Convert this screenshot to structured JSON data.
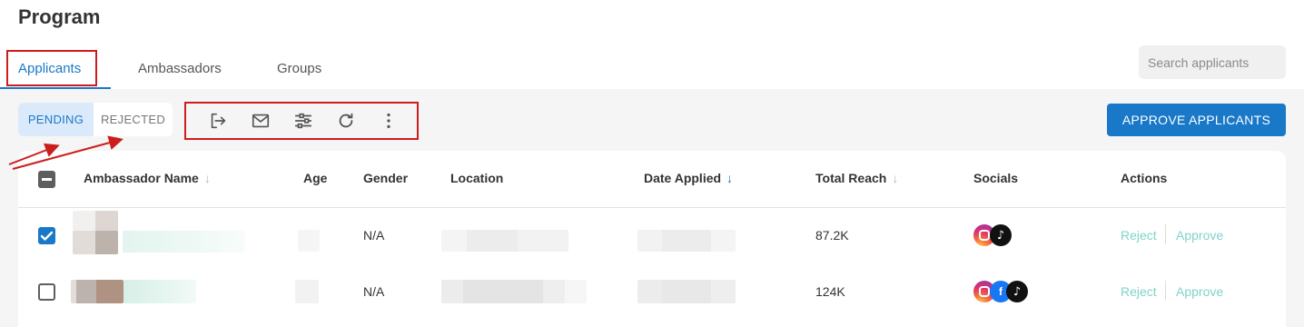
{
  "page": {
    "title": "Program"
  },
  "tabs": [
    {
      "label": "Applicants",
      "active": true
    },
    {
      "label": "Ambassadors",
      "active": false
    },
    {
      "label": "Groups",
      "active": false
    }
  ],
  "search": {
    "placeholder": "Search applicants"
  },
  "status_toggle": {
    "pending": "PENDING",
    "rejected": "REJECTED",
    "selected": "PENDING"
  },
  "toolbar": {
    "icons": [
      "export-icon",
      "mail-icon",
      "filter-sliders-icon",
      "refresh-icon",
      "more-vertical-icon"
    ]
  },
  "approve_button": {
    "label": "APPROVE APPLICANTS"
  },
  "table": {
    "columns": [
      {
        "label": "Ambassador Name",
        "sort": "inactive"
      },
      {
        "label": "Age"
      },
      {
        "label": "Gender"
      },
      {
        "label": "Location"
      },
      {
        "label": "Date Applied",
        "sort": "active"
      },
      {
        "label": "Total Reach",
        "sort": "inactive"
      },
      {
        "label": "Socials"
      },
      {
        "label": "Actions"
      }
    ],
    "header_checkbox": "indeterminate",
    "rows": [
      {
        "checked": true,
        "gender": "N/A",
        "total_reach": "87.2K",
        "socials": [
          "instagram",
          "tiktok"
        ],
        "actions": {
          "reject": "Reject",
          "approve": "Approve"
        }
      },
      {
        "checked": false,
        "gender": "N/A",
        "total_reach": "124K",
        "socials": [
          "instagram",
          "facebook",
          "tiktok"
        ],
        "actions": {
          "reject": "Reject",
          "approve": "Approve"
        }
      }
    ]
  },
  "colors": {
    "accent": "#1978c8",
    "annotation": "#cc1d1d",
    "action_link": "#7fd3c8",
    "pending_bg": "#dbeafb"
  }
}
